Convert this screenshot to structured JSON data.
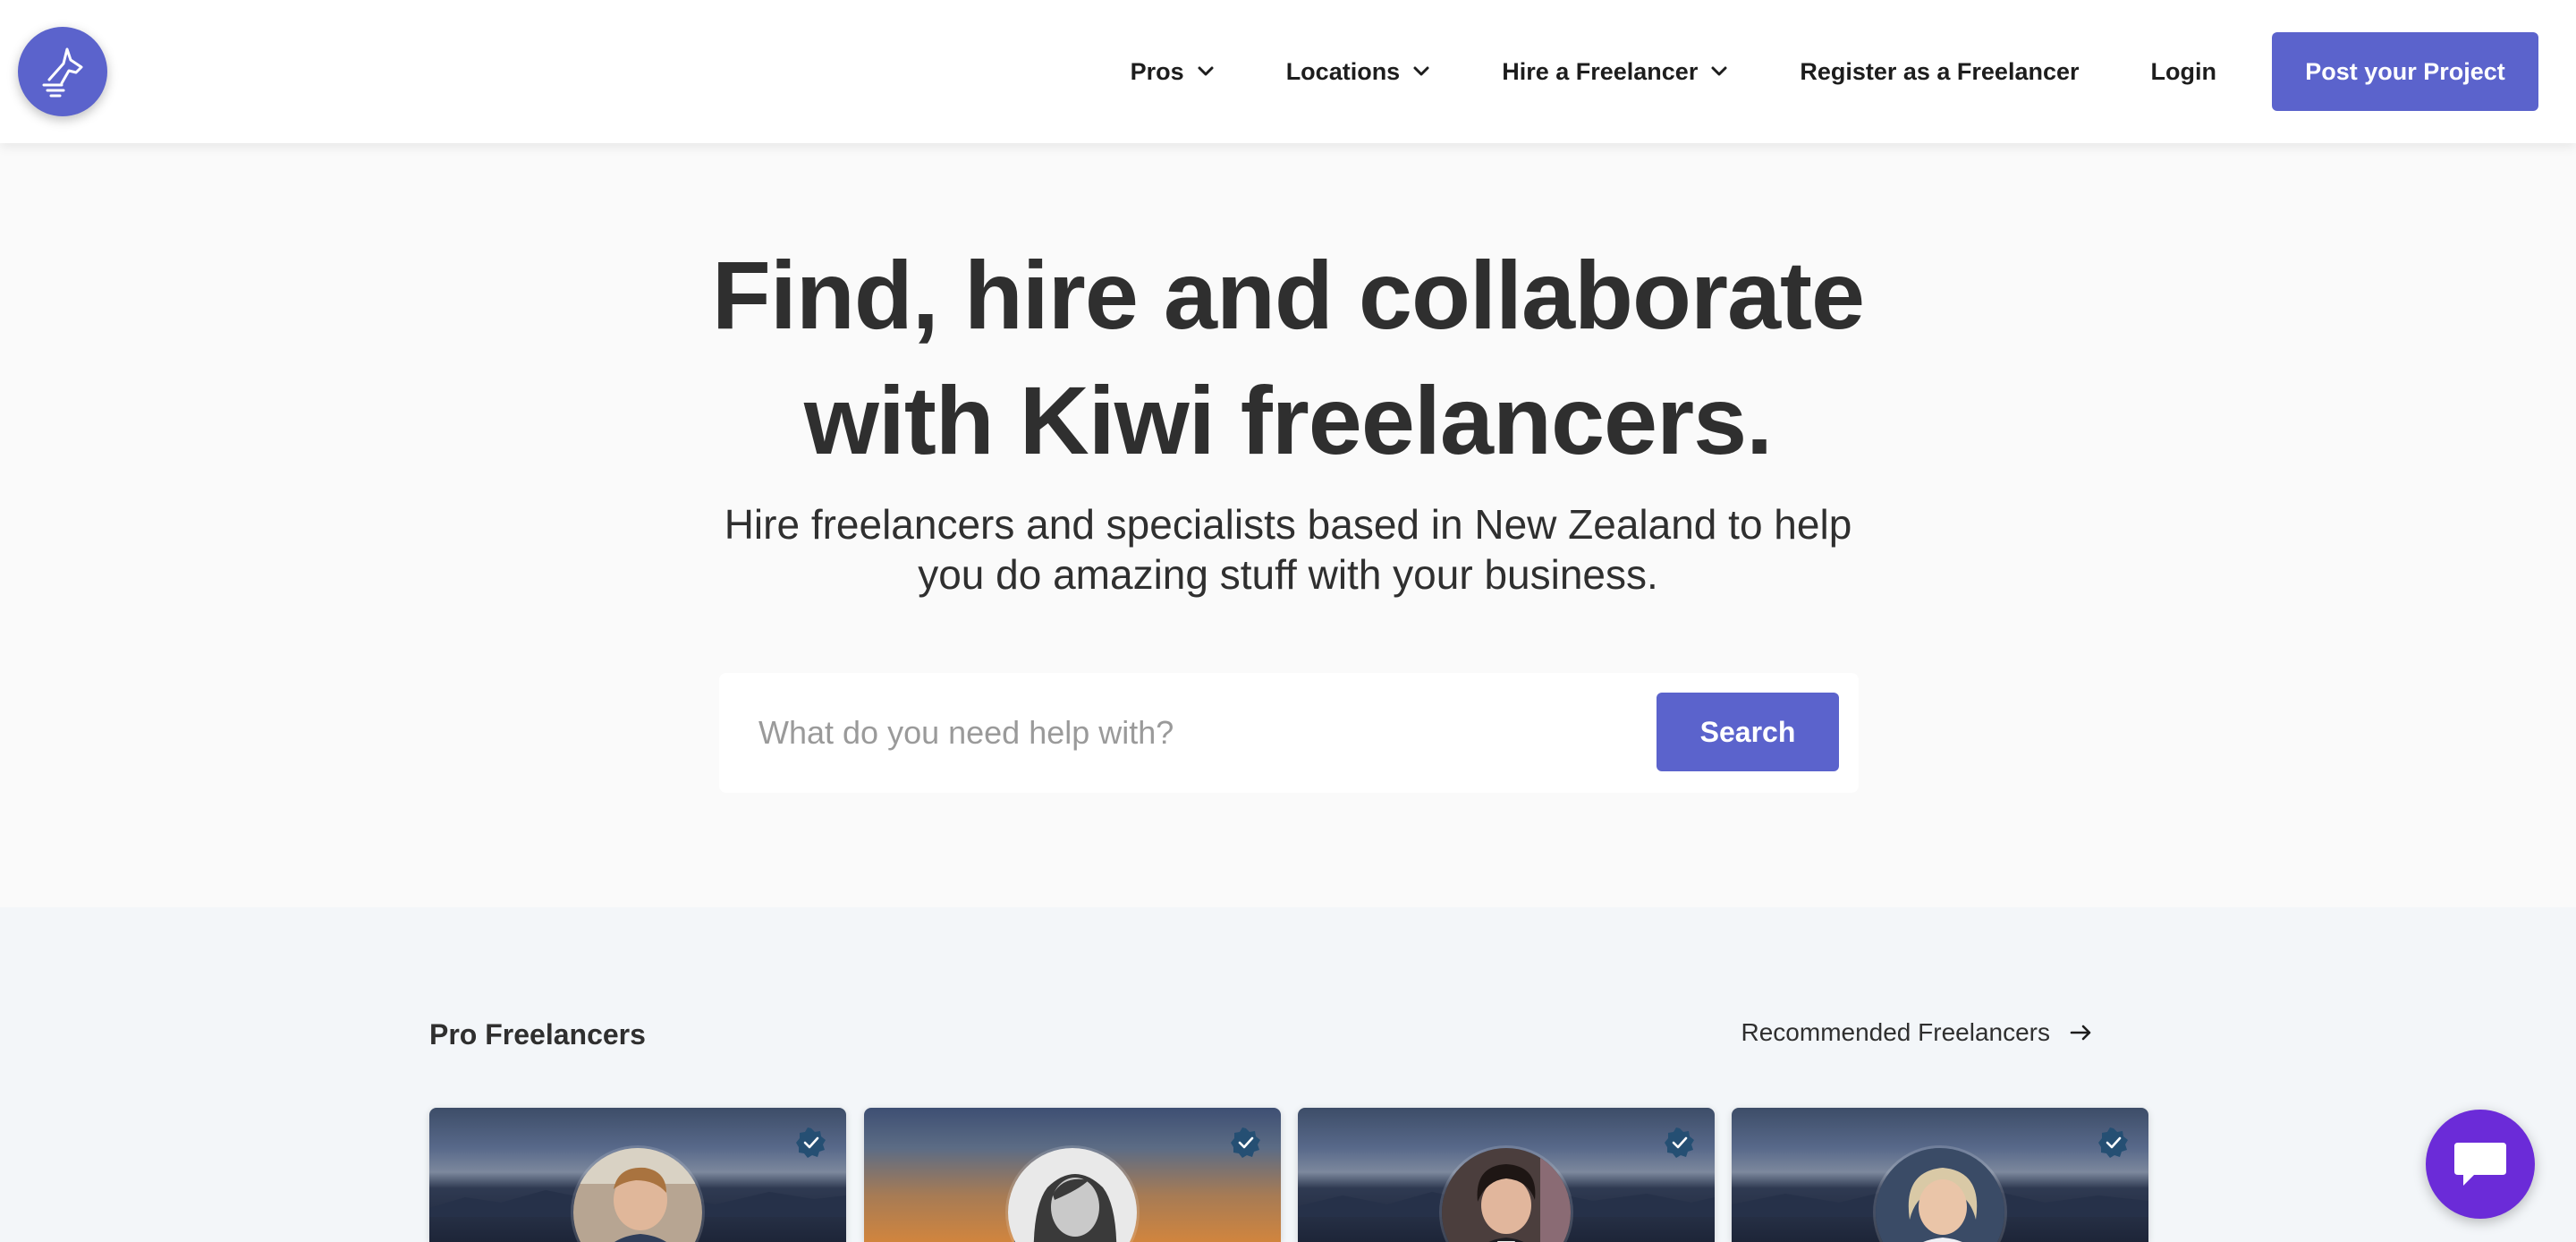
{
  "brand": {
    "logo_icon": "horse-head-icon",
    "accent_color": "#5b63cc"
  },
  "nav": {
    "items": [
      {
        "label": "Pros",
        "has_dropdown": true
      },
      {
        "label": "Locations",
        "has_dropdown": true
      },
      {
        "label": "Hire a Freelancer",
        "has_dropdown": true
      },
      {
        "label": "Register as a Freelancer",
        "has_dropdown": false
      },
      {
        "label": "Login",
        "has_dropdown": false
      }
    ],
    "cta_label": "Post your Project"
  },
  "hero": {
    "title_line1": "Find, hire and collaborate",
    "title_line2": "with Kiwi freelancers.",
    "subtitle_line1": "Hire freelancers and specialists based in New Zealand to help",
    "subtitle_line2": "you do amazing stuff with your business.",
    "search_placeholder": "What do you need help with?",
    "search_value": "",
    "search_button": "Search"
  },
  "pro_section": {
    "title": "Pro Freelancers",
    "link_label": "Recommended Freelancers",
    "link_icon": "arrow-right-icon",
    "cards": [
      {
        "background": "city-night",
        "verified": true
      },
      {
        "background": "sunset-tower",
        "verified": true
      },
      {
        "background": "city-night",
        "verified": true
      },
      {
        "background": "city-night",
        "verified": true
      }
    ]
  },
  "chat": {
    "icon": "chat-bubble-icon",
    "color": "#6b2bd8"
  }
}
